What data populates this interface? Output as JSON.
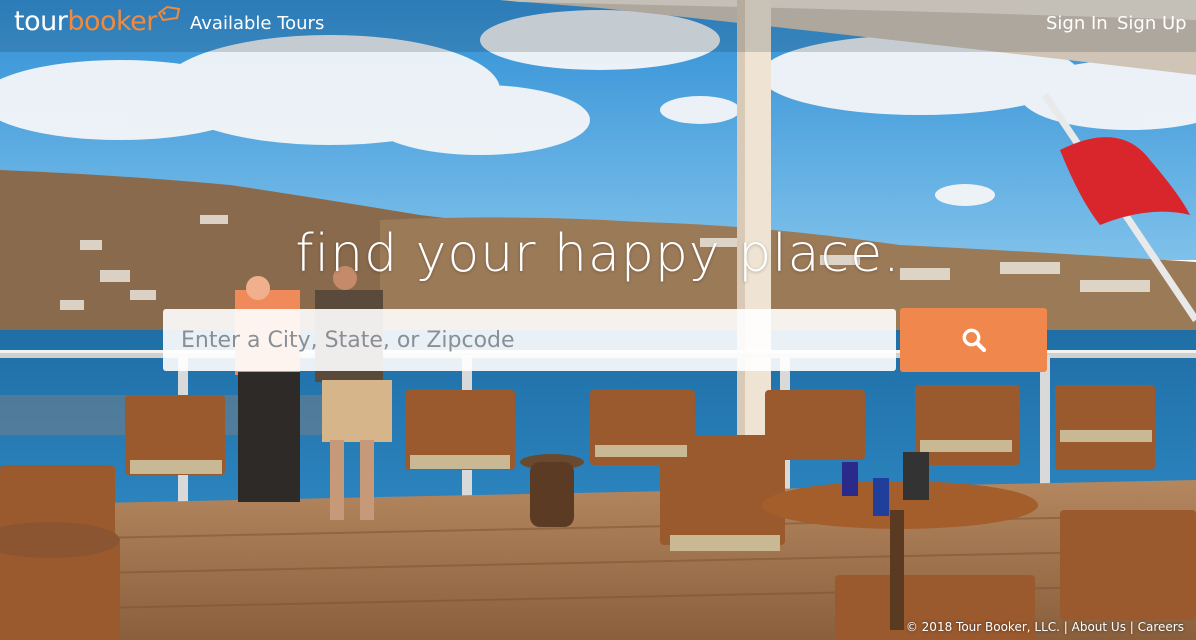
{
  "brand": {
    "part1": "tour",
    "part2": "booker",
    "tag_color": "#f28a3c"
  },
  "nav": {
    "available_tours": "Available Tours",
    "sign_in": "Sign In",
    "sign_up": "Sign Up"
  },
  "hero": {
    "tagline": "find your happy place.",
    "search_placeholder": "Enter a City, State, or Zipcode",
    "search_icon": "search-icon"
  },
  "footer": {
    "copyright": "© 2018 Tour Booker, LLC.",
    "sep1": " | ",
    "about": "About Us",
    "sep2": " | ",
    "careers": "Careers"
  },
  "colors": {
    "accent": "#f0874d",
    "sea": "#1e6fa8",
    "sky": "#3b9ad9"
  }
}
